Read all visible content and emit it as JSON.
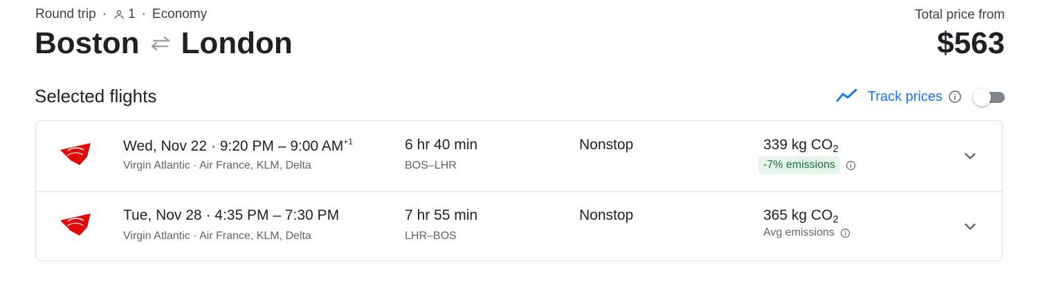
{
  "header": {
    "trip_type": "Round trip",
    "passengers": "1",
    "cabin": "Economy",
    "origin": "Boston",
    "destination": "London",
    "total_label": "Total price from",
    "total_price": "$563"
  },
  "selected_flights": {
    "title": "Selected flights",
    "track_prices_label": "Track prices",
    "track_prices_enabled": false
  },
  "flights": [
    {
      "date": "Wed, Nov 22",
      "time_range": "9:20 PM – 9:00 AM",
      "day_offset": "+1",
      "carriers": "Virgin Atlantic · Air France, KLM, Delta",
      "duration": "6 hr 40 min",
      "airports": "BOS–LHR",
      "stops": "Nonstop",
      "emissions_value": "339 kg CO",
      "emissions_sub": "2",
      "emissions_note": "-7% emissions"
    },
    {
      "date": "Tue, Nov 28",
      "time_range": "4:35 PM – 7:30 PM",
      "day_offset": "",
      "carriers": "Virgin Atlantic · Air France, KLM, Delta",
      "duration": "7 hr 55 min",
      "airports": "LHR–BOS",
      "stops": "Nonstop",
      "emissions_value": "365 kg CO",
      "emissions_sub": "2",
      "emissions_note": "Avg emissions"
    }
  ],
  "colors": {
    "accent": "#1a73e8",
    "airline_logo": "#e10a0a",
    "emissions_badge_bg": "#e6f4ea",
    "emissions_badge_text": "#137333"
  },
  "icons": {
    "person": "person-icon",
    "swap": "swap-arrows-icon",
    "track": "trend-line-icon",
    "info": "info-icon",
    "airline": "virgin-atlantic-logo-icon",
    "expand": "chevron-down-icon"
  }
}
